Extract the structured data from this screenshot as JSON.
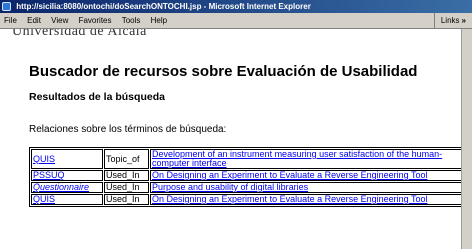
{
  "window": {
    "title": "http://sicilia:8080/ontochi/doSearchONTOCHI.jsp - Microsoft Internet Explorer"
  },
  "menu": {
    "items": [
      "File",
      "Edit",
      "View",
      "Favorites",
      "Tools",
      "Help"
    ],
    "links_label": "Links",
    "links_chevron": "»"
  },
  "page": {
    "logo_text": "Universidad de Alcalá",
    "title": "Buscador de recursos sobre Evaluación de Usabilidad",
    "subtitle": "Resultados de la búsqueda",
    "relations_intro": "Relaciones sobre los términos de búsqueda:"
  },
  "results": [
    {
      "term": "QUIS",
      "relation": "Topic_of",
      "resource": "Development of an instrument measuring user satisfaction of the human-computer interface"
    },
    {
      "term": "PSSUQ",
      "relation": "Used_In",
      "resource": "On Designing an Experiment to Evaluate a Reverse Engineering Tool"
    },
    {
      "term": "Questionnaire",
      "relation": "Used_In",
      "resource": "Purpose and usability of digital libraries"
    },
    {
      "term": "QUIS",
      "relation": "Used_In",
      "resource": "On Designing an Experiment to Evaluate a Reverse Engineering Tool"
    }
  ]
}
